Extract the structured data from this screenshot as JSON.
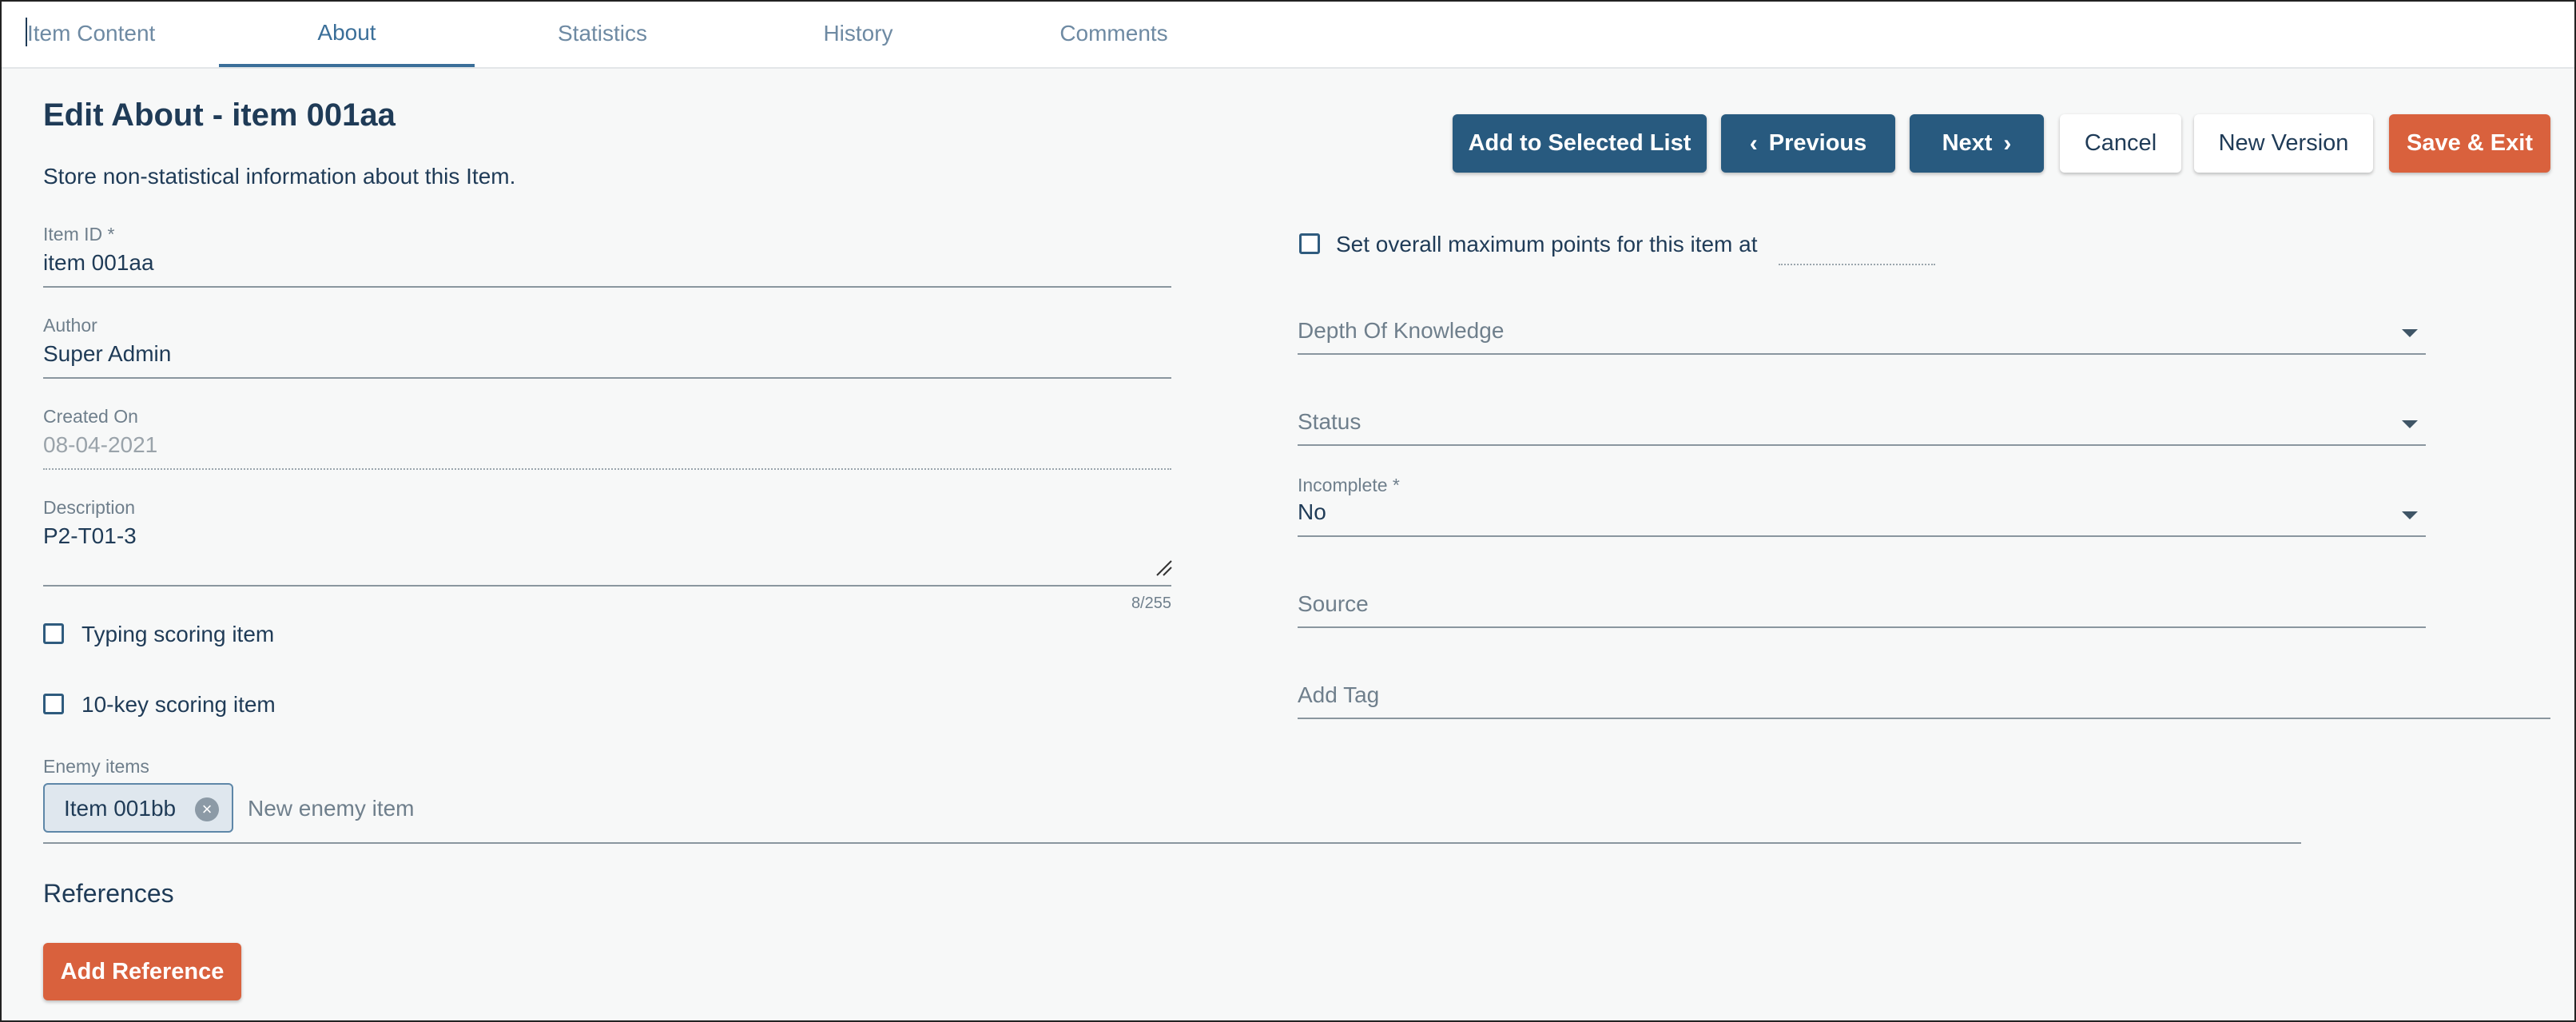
{
  "tabs": [
    {
      "label": "Item Content"
    },
    {
      "label": "About"
    },
    {
      "label": "Statistics"
    },
    {
      "label": "History"
    },
    {
      "label": "Comments"
    }
  ],
  "page": {
    "title": "Edit About - item 001aa",
    "subtitle": "Store non-statistical information about this Item."
  },
  "toolbar": {
    "add_to_list": "Add to Selected List",
    "previous": "Previous",
    "next": "Next",
    "cancel": "Cancel",
    "new_version": "New Version",
    "save_exit": "Save & Exit"
  },
  "left": {
    "item_id": {
      "label": "Item ID *",
      "value": "item 001aa"
    },
    "author": {
      "label": "Author",
      "value": "Super Admin"
    },
    "created_on": {
      "label": "Created On",
      "value": "08-04-2021"
    },
    "description": {
      "label": "Description",
      "value": "P2-T01-3",
      "counter": "8/255"
    },
    "typing_scoring": "Typing scoring item",
    "tenkey_scoring": "10-key scoring item",
    "enemy_items": {
      "label": "Enemy items",
      "chips": [
        "Item 001bb"
      ],
      "placeholder": "New enemy item"
    },
    "references": {
      "title": "References",
      "add_button": "Add Reference"
    }
  },
  "right": {
    "max_points_label": "Set overall maximum points for this item at",
    "depth_of_knowledge": "Depth Of Knowledge",
    "status": "Status",
    "incomplete": {
      "label": "Incomplete *",
      "value": "No"
    },
    "source": "Source",
    "add_tag": "Add Tag"
  },
  "colors": {
    "primary": "#285a7f",
    "accent": "#d9613d",
    "text": "#1f3b57"
  },
  "icons": {
    "previous": "chevron-left-icon",
    "next": "chevron-right-icon",
    "dropdown": "caret-down-icon",
    "chip_remove": "close-circle-icon",
    "textarea_resize": "resize-handle-icon"
  }
}
